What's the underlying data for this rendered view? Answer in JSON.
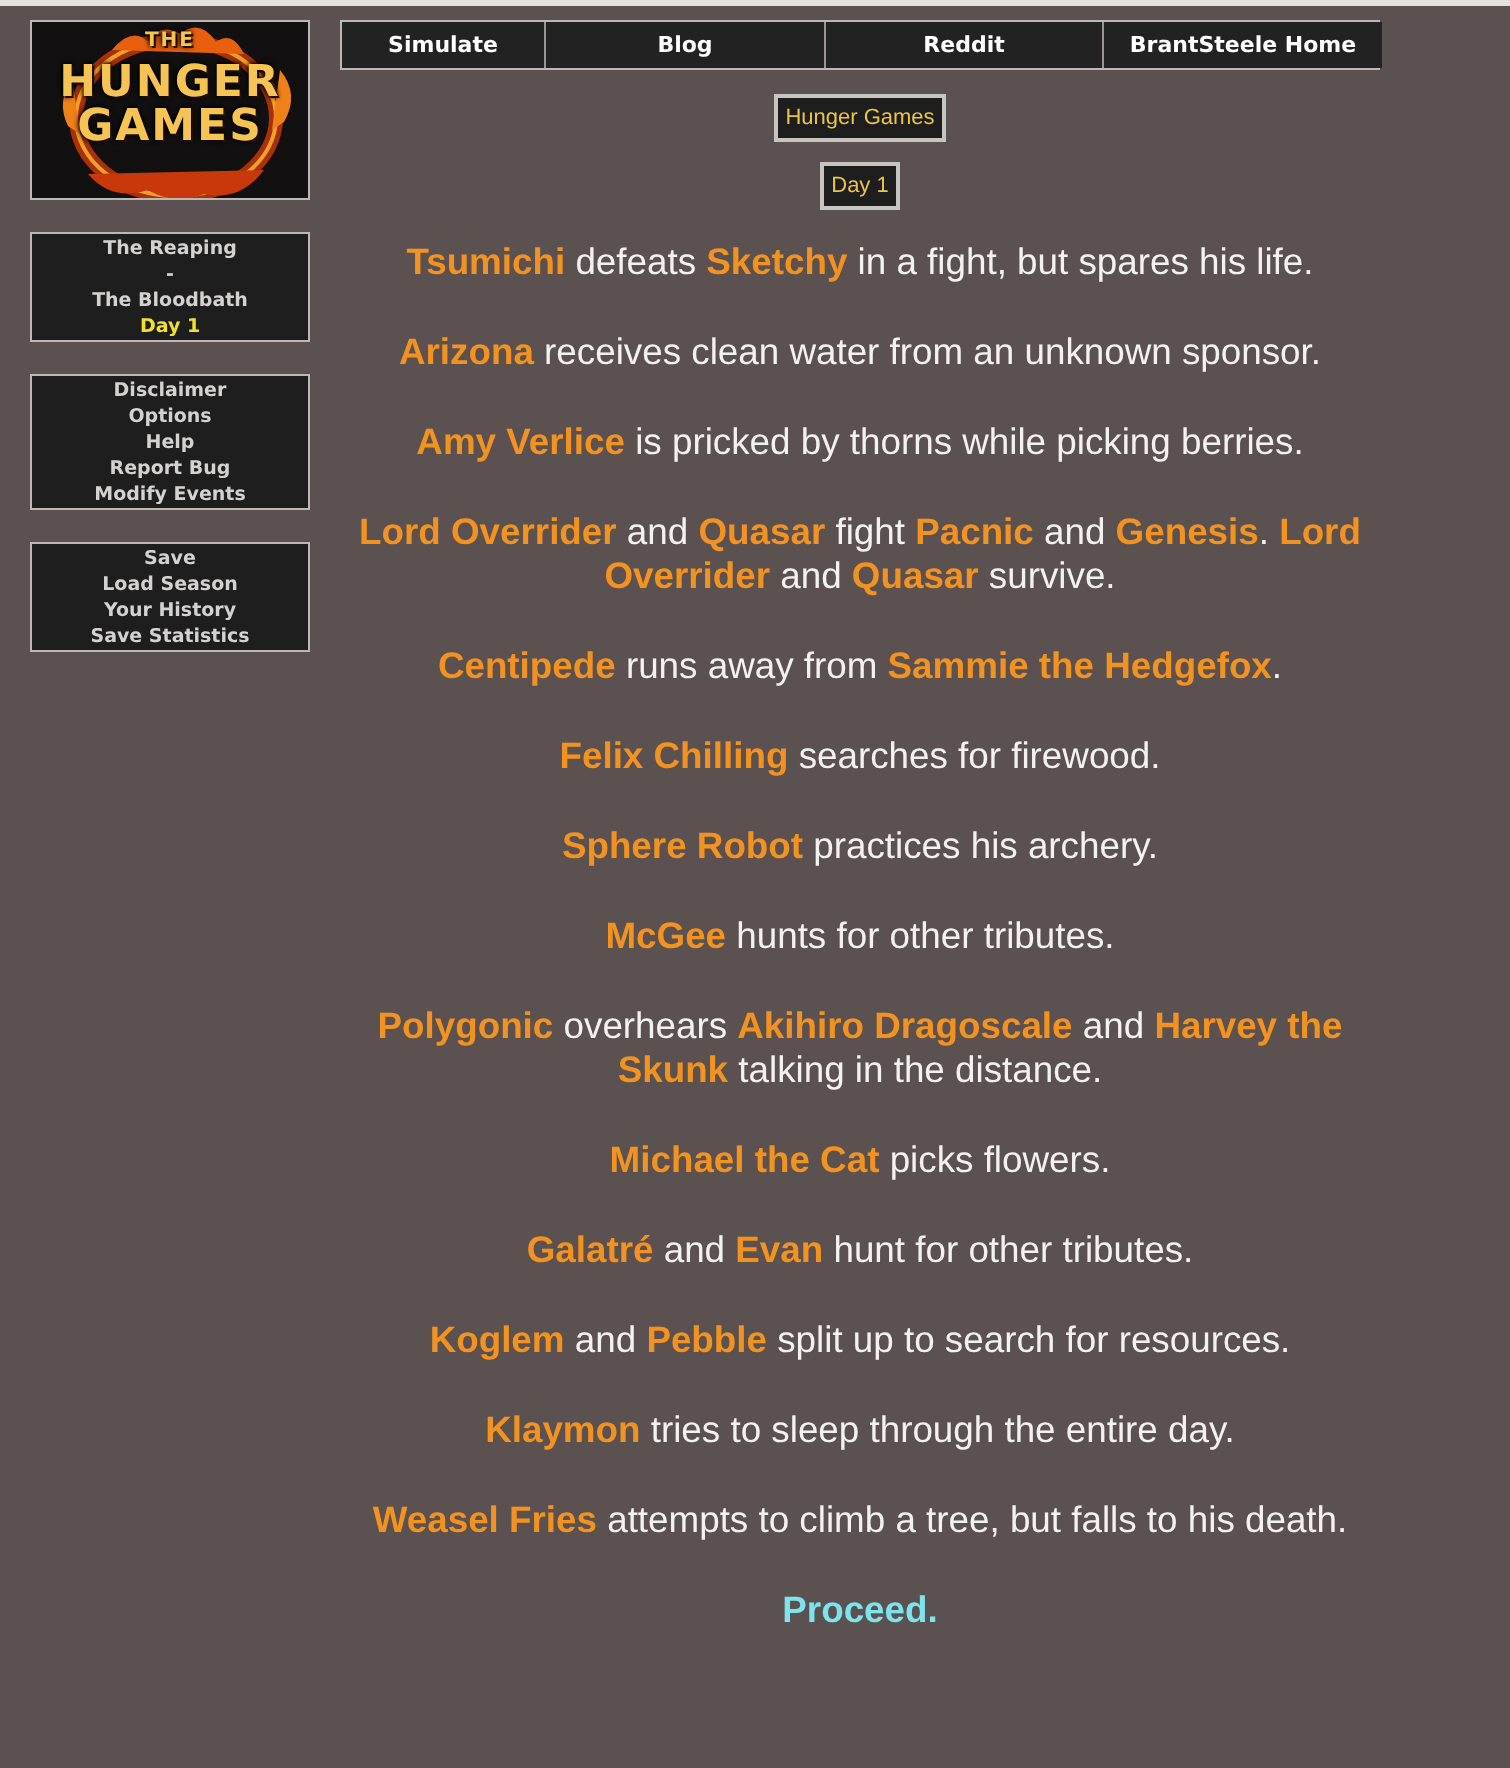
{
  "logo": {
    "lines": [
      "THE",
      "HUNGER",
      "GAMES"
    ]
  },
  "sidebar": {
    "groups": [
      {
        "items": [
          {
            "label": "The Reaping",
            "selected": false
          },
          {
            "label": "-",
            "selected": false
          },
          {
            "label": "The Bloodbath",
            "selected": false
          },
          {
            "label": "Day 1",
            "selected": true
          }
        ]
      },
      {
        "items": [
          {
            "label": "Disclaimer"
          },
          {
            "label": "Options"
          },
          {
            "label": "Help"
          },
          {
            "label": "Report Bug"
          },
          {
            "label": "Modify Events"
          }
        ]
      },
      {
        "items": [
          {
            "label": "Save"
          },
          {
            "label": "Load Season"
          },
          {
            "label": "Your History"
          },
          {
            "label": "Save Statistics"
          }
        ]
      }
    ]
  },
  "nav": [
    "Simulate",
    "Blog",
    "Reddit",
    "BrantSteele Home"
  ],
  "season_title": "Hunger Games",
  "day_title": "Day 1",
  "events": [
    "**Tsumichi** defeats **Sketchy** in a fight, but spares his life.",
    "**Arizona** receives clean water from an unknown sponsor.",
    "**Amy Verlice** is pricked by thorns while picking berries.",
    "**Lord Overrider** and **Quasar** fight **Pacnic** and **Genesis**. **Lord Overrider** and **Quasar** survive.",
    "**Centipede** runs away from **Sammie the Hedgefox**.",
    "**Felix Chilling** searches for firewood.",
    "**Sphere Robot** practices his archery.",
    "**McGee** hunts for other tributes.",
    "**Polygonic** overhears **Akihiro Dragoscale** and **Harvey the Skunk** talking in the distance.",
    "**Michael the Cat** picks flowers.",
    "**Galatré** and **Evan** hunt for other tributes.",
    "**Koglem** and **Pebble** split up to search for resources.",
    "**Klaymon** tries to sleep through the entire day.",
    "**Weasel Fries** attempts to climb a tree, but falls to his death."
  ],
  "proceed_link": "Proceed."
}
